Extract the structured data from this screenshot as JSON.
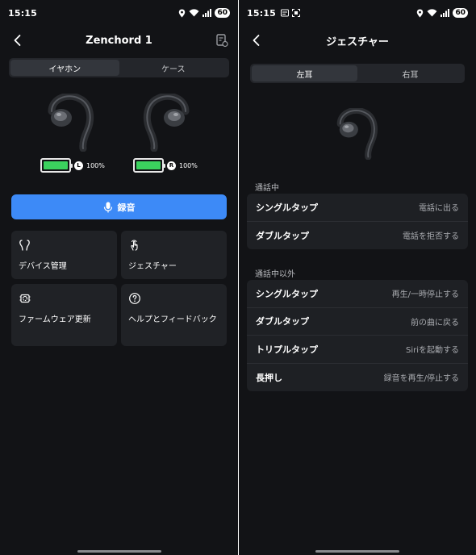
{
  "left": {
    "status": {
      "time": "15:15",
      "battery": "60"
    },
    "header": {
      "title": "Zenchord 1"
    },
    "tabs": [
      {
        "label": "イヤホン",
        "active": true
      },
      {
        "label": "ケース",
        "active": false
      }
    ],
    "earbuds": [
      {
        "side": "L",
        "battery": "100%"
      },
      {
        "side": "R",
        "battery": "100%"
      }
    ],
    "record_label": "録音",
    "tiles": [
      {
        "label": "デバイス管理",
        "icon": "earbuds-icon"
      },
      {
        "label": "ジェスチャー",
        "icon": "gesture-icon"
      },
      {
        "label": "ファームウェア更新",
        "icon": "firmware-icon"
      },
      {
        "label": "ヘルプとフィードバック",
        "icon": "help-icon"
      }
    ]
  },
  "right": {
    "status": {
      "time": "15:15",
      "battery": "60"
    },
    "header": {
      "title": "ジェスチャー"
    },
    "tabs": [
      {
        "label": "左耳",
        "active": true
      },
      {
        "label": "右耳",
        "active": false
      }
    ],
    "sections": [
      {
        "label": "通話中",
        "rows": [
          {
            "gesture": "シングルタップ",
            "action": "電話に出る"
          },
          {
            "gesture": "ダブルタップ",
            "action": "電話を拒否する"
          }
        ]
      },
      {
        "label": "通話中以外",
        "rows": [
          {
            "gesture": "シングルタップ",
            "action": "再生/一時停止する"
          },
          {
            "gesture": "ダブルタップ",
            "action": "前の曲に戻る"
          },
          {
            "gesture": "トリプルタップ",
            "action": "Siriを起動する"
          },
          {
            "gesture": "長押し",
            "action": "録音を再生/停止する"
          }
        ]
      }
    ]
  },
  "colors": {
    "background": "#121316",
    "accent": "#3d8af7",
    "battery": "#3bd25e",
    "card": "#1e2024"
  }
}
